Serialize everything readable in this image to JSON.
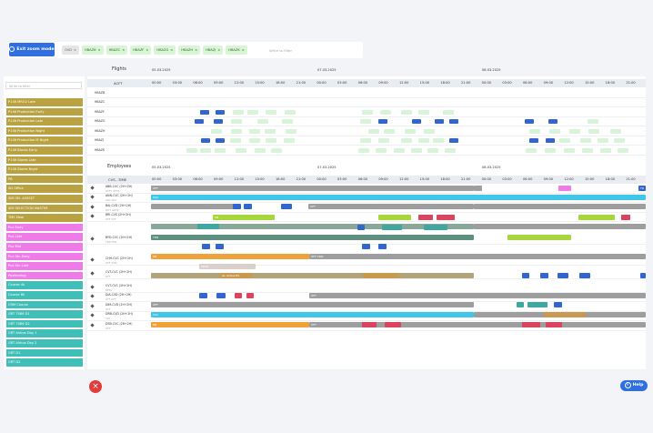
{
  "toolbar": {
    "focus_label": "Exit zoom mode",
    "filter_chips": [
      "OVD",
      "HBAZB",
      "HBAZC",
      "HBAZF",
      "HBAZG",
      "HBAZH",
      "HBAZJ",
      "HBAZK"
    ],
    "filter_placeholder": "Write to filter"
  },
  "left_panel": {
    "search_placeholder": "Write to filter",
    "items": [
      {
        "label": "P146 MRO2 Late",
        "color": "#b9a23f"
      },
      {
        "label": "P146 Production Early",
        "color": "#b9a23f"
      },
      {
        "label": "P146 Production Late",
        "color": "#b9a23f"
      },
      {
        "label": "P146 Production Night",
        "color": "#b9a23f"
      },
      {
        "label": "P146 Production M Night",
        "color": "#b9a23f"
      },
      {
        "label": "P146 Blocks Early",
        "color": "#b9a23f"
      },
      {
        "label": "P146 Stores Late",
        "color": "#b9a23f"
      },
      {
        "label": "P146 Stores Night",
        "color": "#b9a23f"
      },
      {
        "label": "PB",
        "color": "#b9a23f"
      },
      {
        "label": "SD Office",
        "color": "#b9a23f"
      },
      {
        "label": "SIM SEL ASSSET",
        "color": "#b9a23f"
      },
      {
        "label": "SIM SELECTION MASTER",
        "color": "#b9a23f"
      },
      {
        "label": "TMS Meal",
        "color": "#b9a23f"
      },
      {
        "label": "Pco Early",
        "color": "#ef7be8"
      },
      {
        "label": "Pco Late",
        "color": "#ef7be8"
      },
      {
        "label": "Pco Mid",
        "color": "#ef7be8"
      },
      {
        "label": "Pco Stn Early",
        "color": "#ef7be8"
      },
      {
        "label": "Pco Stn Late",
        "color": "#ef7be8"
      },
      {
        "label": "Positioning",
        "color": "#ef7be8"
      },
      {
        "label": "Course 4h",
        "color": "#3fbfb7"
      },
      {
        "label": "Course 8h",
        "color": "#3fbfb7"
      },
      {
        "label": "CRM Course",
        "color": "#3fbfb7"
      },
      {
        "label": "GRT 7086 D1",
        "color": "#3fbfb7"
      },
      {
        "label": "GRT 7086 D2",
        "color": "#3fbfb7"
      },
      {
        "label": "GRT Airbus Day 1",
        "color": "#3fbfb7"
      },
      {
        "label": "GRT Airbus Day 2",
        "color": "#3fbfb7"
      },
      {
        "label": "GRT D1",
        "color": "#3fbfb7"
      },
      {
        "label": "GRT D2",
        "color": "#3fbfb7"
      }
    ]
  },
  "flights": {
    "title": "Flights",
    "col_label": "ACFT",
    "dates": [
      "05.03.2025",
      "07.03.2025",
      "08.03.2025"
    ],
    "ticks": [
      "00:00",
      "03:00",
      "06:00",
      "09:00",
      "12:00",
      "15:00",
      "18:00",
      "21:00",
      "00:00",
      "03:00",
      "06:00",
      "09:00",
      "12:00",
      "15:00",
      "18:00",
      "21:00",
      "00:00",
      "03:00",
      "06:00",
      "09:00",
      "12:00",
      "15:00",
      "18:00",
      "21:00"
    ],
    "rows": [
      "HBAZB",
      "HBAZC",
      "HBAZF",
      "HBAZG",
      "HBAZH",
      "HBAZJ",
      "HBAZK"
    ]
  },
  "employees": {
    "title": "Employees",
    "col_label": "CVS, -TIME",
    "dates": [
      "05.03.2025",
      "07.03.2025",
      "08.03.2025"
    ],
    "ticks": [
      "00:00",
      "03:00",
      "06:00",
      "09:00",
      "12:00",
      "15:00",
      "18:00",
      "21:00",
      "00:00",
      "03:00",
      "06:00",
      "09:00",
      "12:00",
      "15:00",
      "18:00",
      "21:00",
      "00:00",
      "03:00",
      "06:00",
      "09:00",
      "12:00",
      "15:00",
      "18:00",
      "21:00"
    ],
    "rows": [
      {
        "label": "ABB-CVC (2H+2H)",
        "sub": "OFF1 OFF2"
      },
      {
        "label": "ANN-CVC (2H+2H)",
        "sub": "VAC VAC"
      },
      {
        "label": "BAI-CVD (2H+2H)",
        "sub": "GOT GR52"
      },
      {
        "label": "BRI-CVS (2H+2H)",
        "sub": "OFF OFF"
      },
      {
        "label": "BYD-CVC (2H+2H)",
        "sub": "TRN FMS"
      },
      {
        "label": "CHH-CVC (2H+2H)",
        "sub": "OFF VDN"
      },
      {
        "label": "CVT-CVC (2H+2H)",
        "sub": "OFF"
      },
      {
        "label": "CVT-CVC (2H+2H)",
        "sub": "RESV"
      },
      {
        "label": "DIA-CVD (2H+2H)",
        "sub": "OFF OFF"
      },
      {
        "label": "DIM-CVD (2H+2H)",
        "sub": "OFF"
      },
      {
        "label": "DRB-CVD (2H+2H)",
        "sub": "VAC"
      },
      {
        "label": "DSB-CVC (2H+2H)",
        "sub": "OFF"
      }
    ]
  },
  "bars": {
    "off": "OFF",
    "vac": "VAC",
    "sb": "SB",
    "off_vdn": "OFF VDN",
    "prsm": "PRSM",
    "trn": "TRN",
    "airbus": "GL Airbus B1",
    "tr": "TR"
  },
  "buttons": {
    "help": "Help",
    "close": "×"
  }
}
